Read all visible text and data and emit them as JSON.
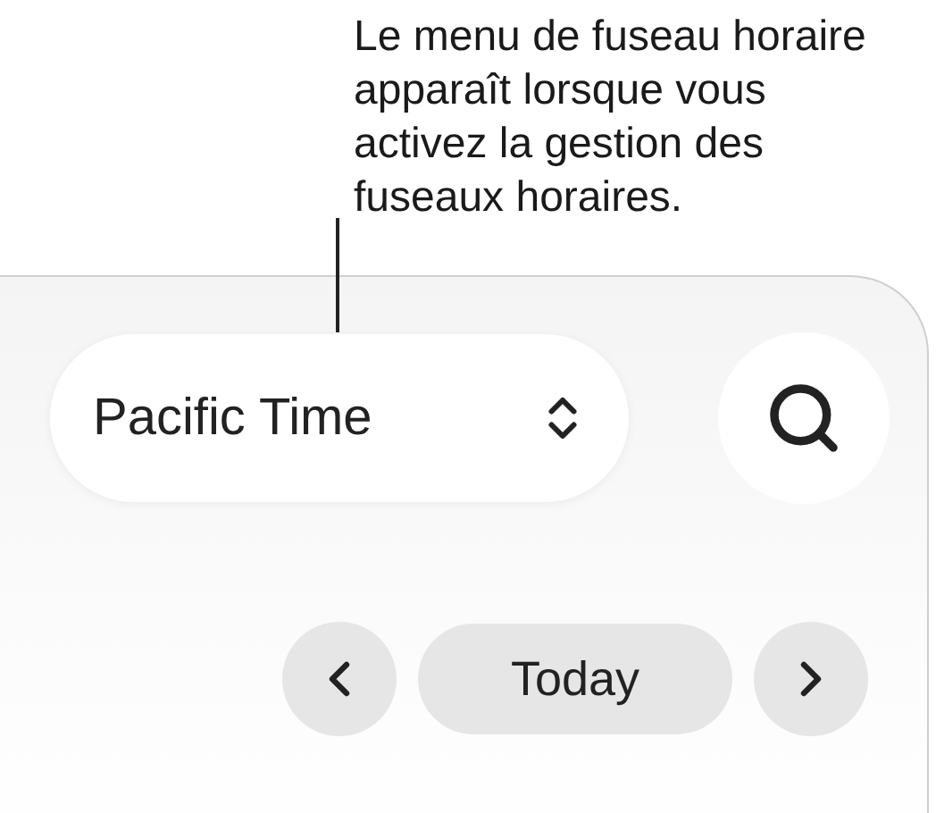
{
  "callout": {
    "text": "Le menu de fuseau horaire apparaît lorsque vous activez la gestion des fuseaux horaires."
  },
  "toolbar": {
    "time_zone_menu": {
      "value": "Pacific Time"
    }
  },
  "navigation": {
    "today_button": {
      "label": "Today"
    }
  }
}
